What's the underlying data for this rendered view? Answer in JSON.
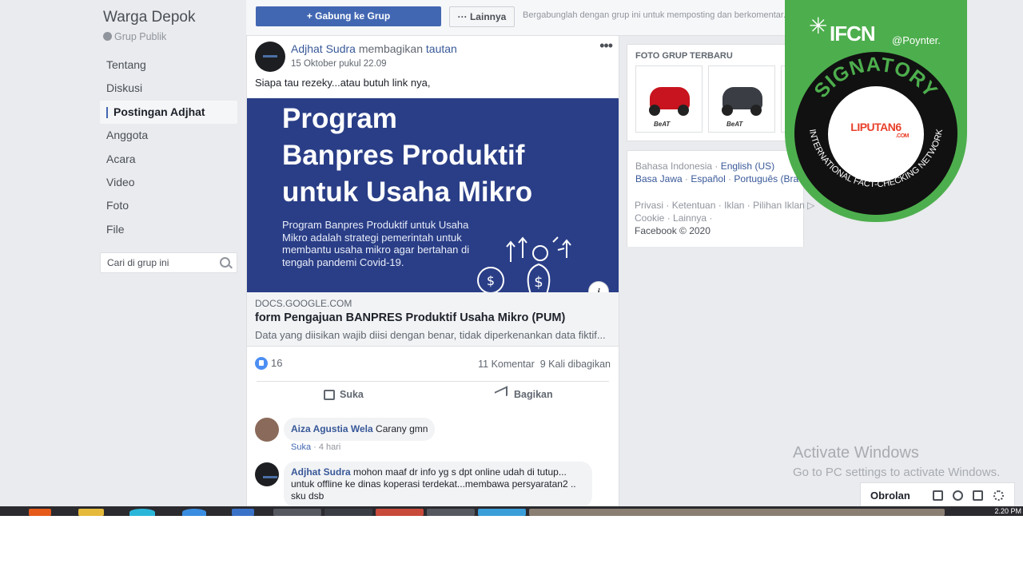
{
  "sidebar": {
    "group_name": "Warga Depok",
    "group_type": "Grup Publik",
    "nav": [
      {
        "label": "Tentang"
      },
      {
        "label": "Diskusi"
      },
      {
        "label": "Postingan Adjhat",
        "active": true
      },
      {
        "label": "Anggota"
      },
      {
        "label": "Acara"
      },
      {
        "label": "Video"
      },
      {
        "label": "Foto"
      },
      {
        "label": "File"
      }
    ],
    "search_placeholder": "Cari di grup ini"
  },
  "topbar": {
    "join_label": "+ Gabung ke Grup",
    "more_label": "··· Lainnya",
    "join_text": "Bergabunglah dengan grup ini untuk memposting dan berkomentar."
  },
  "post": {
    "author": "Adjhat Sudra",
    "action_text": "membagikan",
    "action_link": "tautan",
    "timestamp": "15 Oktober pukul 22.09",
    "text": "Siapa tau rezeky...atau butuh link nya,",
    "image_title": [
      "Program",
      "Banpres Produktif",
      "untuk Usaha Mikro"
    ],
    "image_body": "Program Banpres Produktif untuk Usaha Mikro adalah strategi pemerintah untuk membantu usaha mikro agar bertahan di tengah pandemi Covid-19.",
    "link_domain": "DOCS.GOOGLE.COM",
    "link_title": "form Pengajuan BANPRES Produktif Usaha Mikro (PUM)",
    "link_desc": "Data yang diisikan wajib diisi dengan benar, tidak diperkenankan data fiktif...",
    "likes": "16",
    "comments_count": "11 Komentar",
    "shares_count": "9 Kali dibagikan",
    "like_label": "Suka",
    "share_label": "Bagikan",
    "comments": [
      {
        "name": "Aiza Agustia Wela",
        "text": "Carany gmn",
        "like": "Suka",
        "age": "4 hari"
      },
      {
        "name": "Adjhat Sudra",
        "text": "mohon maaf dr info yg s dpt online udah di tutup... untuk offline ke dinas koperasi terdekat...membawa persyaratan2 .. sku dsb"
      }
    ]
  },
  "right": {
    "photos_header": "FOTO GRUP TERBARU",
    "photo_brand": "BeAT",
    "langs_line1_current": "Bahasa Indonesia",
    "langs_line1_link": "English (US)",
    "langs_line2": [
      "Basa Jawa",
      "Español",
      "Português (Bra"
    ],
    "footer_line1": [
      "Privasi",
      "Ketentuan",
      "Iklan",
      "Pilihan Iklan"
    ],
    "footer_line2": [
      "Cookie",
      "Lainnya"
    ],
    "copyright": "Facebook © 2020"
  },
  "badge": {
    "ifcn": "IFCN",
    "poynter": "@Poynter.",
    "signatory": "SIGNATORY",
    "network": "INTERNATIONAL FACT-CHECKING NETWORK",
    "member": "LIPUTAN6",
    "member_domain": ".COM",
    "colors": {
      "green": "#4dae4d",
      "seal": "#111111",
      "liputan": "#e8402a"
    }
  },
  "watermark": {
    "title": "Activate Windows",
    "subtitle": "Go to PC settings to activate Windows."
  },
  "chat": {
    "label": "Obrolan"
  },
  "taskbar": {
    "clock": "2.20 PM"
  },
  "colors": {
    "facebook_blue": "#4267b2",
    "link": "#385898",
    "page_bg": "#e9ebee"
  }
}
